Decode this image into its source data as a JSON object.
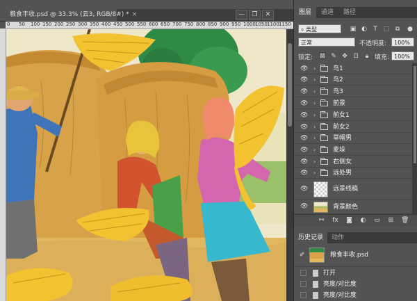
{
  "document": {
    "tab_title": "粮食丰收.psd @ 33.3% (云3, RGB/8#) *",
    "tab_close": "×",
    "window_buttons": [
      "—",
      "❐",
      "✕"
    ],
    "ruler_ticks": [
      "0",
      "50",
      "100",
      "150",
      "200",
      "250",
      "300",
      "350",
      "400",
      "450",
      "500",
      "550",
      "600",
      "650",
      "700",
      "750",
      "800",
      "850",
      "900",
      "950",
      "1000",
      "1050",
      "1100",
      "1150"
    ]
  },
  "panel": {
    "tabs": [
      "图层",
      "通道",
      "路径"
    ],
    "active_tab": "图层",
    "filter_kind": "类型",
    "blend_mode": "正常",
    "opacity_label": "不透明度:",
    "opacity_value": "100%",
    "lock_label": "锁定:",
    "fill_label": "填充:",
    "fill_value": "100%",
    "layers": [
      {
        "name": "鸟1",
        "type": "group"
      },
      {
        "name": "鸟2",
        "type": "group"
      },
      {
        "name": "鸟3",
        "type": "group"
      },
      {
        "name": "前景",
        "type": "group"
      },
      {
        "name": "前女1",
        "type": "group"
      },
      {
        "name": "前女2",
        "type": "group"
      },
      {
        "name": "草帽男",
        "type": "group"
      },
      {
        "name": "麦垛",
        "type": "group"
      },
      {
        "name": "右侧女",
        "type": "group"
      },
      {
        "name": "远处男",
        "type": "group"
      },
      {
        "name": "远景线稿",
        "type": "layer"
      },
      {
        "name": "背景颜色",
        "type": "layer"
      }
    ],
    "layer_tools": [
      "⚯",
      "fx",
      "◙",
      "◐",
      "▭",
      "⊞",
      "🗑"
    ]
  },
  "history": {
    "tabs": [
      "历史记录",
      "动作"
    ],
    "active_tab": "历史记录",
    "snapshot_name": "粮食丰收.psd",
    "items": [
      "打开",
      "亮度/对比度",
      "亮度/对比度"
    ]
  },
  "colors": {
    "ui_dark": "#535353",
    "ui_darker": "#3b3b3b",
    "sky": "#f2eed6",
    "hay": "#d9a441",
    "straw": "#f2c230",
    "green_tree": "#2f8a45"
  }
}
